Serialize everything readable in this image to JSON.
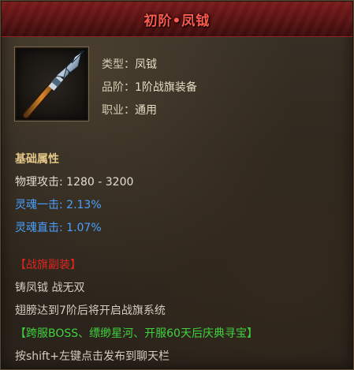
{
  "item": {
    "name": "初阶•凤钺",
    "type_label": "类型：",
    "type_value": "凤钺",
    "grade_label": "品阶：",
    "grade_value": "1阶战旗装备",
    "class_label": "职业：",
    "class_value": "通用",
    "icon": "spear-icon"
  },
  "attributes": {
    "section_title": "基础属性",
    "physical_attack_label": "物理攻击:",
    "physical_attack_value": "1280 - 3200",
    "soul_strike_label": "灵魂一击:",
    "soul_strike_value": "2.13%",
    "soul_critical_label": "灵魂直击:",
    "soul_critical_value": "1.07%"
  },
  "description": {
    "tag": "【战旗副装】",
    "line1": "铸凤钺 战无双",
    "line2": "翅膀达到7阶后将开启战旗系统",
    "line3": "【跨服BOSS、缥缈星河、开服60天后庆典寻宝】",
    "line4": "按shift+左键点击发布到聊天栏"
  },
  "colors": {
    "title": "#ff5a4e",
    "section": "#e6c98a",
    "blue": "#4aa0ff",
    "red": "#e0251e",
    "green": "#3fd23f"
  }
}
